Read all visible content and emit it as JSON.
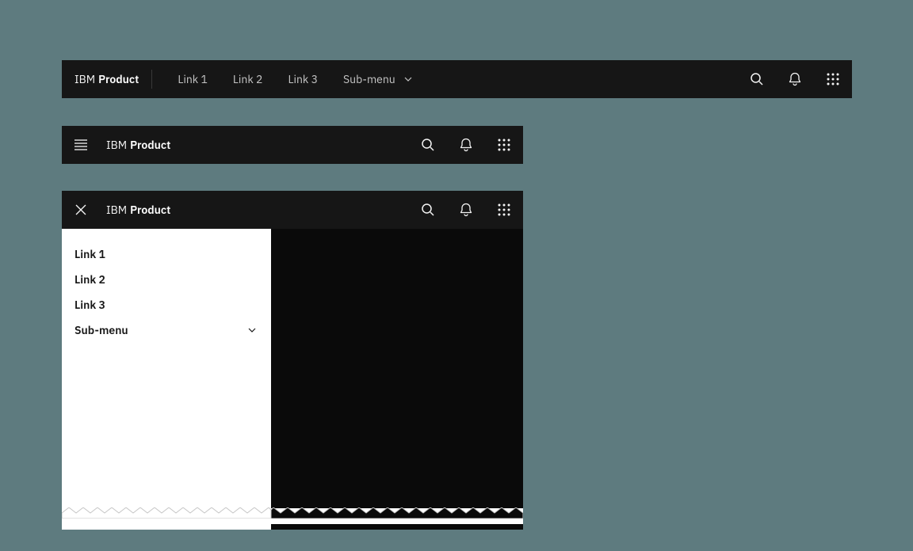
{
  "brand": {
    "prefix": "IBM",
    "name": "Product"
  },
  "nav": {
    "links": [
      "Link 1",
      "Link 2",
      "Link 3"
    ],
    "submenu": "Sub-menu"
  },
  "side_menu": {
    "links": [
      "Link 1",
      "Link 2",
      "Link 3"
    ],
    "submenu": "Sub-menu"
  }
}
